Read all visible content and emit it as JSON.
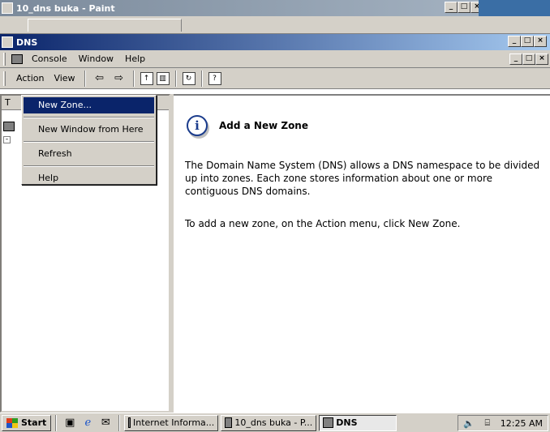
{
  "paint_window": {
    "title": "10_dns buka - Paint",
    "icon": "paint-icon"
  },
  "dns_window": {
    "title": "DNS",
    "icon": "dns-icon"
  },
  "window_buttons": {
    "minimize": "_",
    "maximize": "□",
    "close": "×"
  },
  "menubar": {
    "console": "Console",
    "window": "Window",
    "help": "Help"
  },
  "toolbar": {
    "action": "Action",
    "view": "View",
    "icons": [
      "back-arrow-icon",
      "forward-arrow-icon",
      "up-folder-icon",
      "show-hide-tree-icon",
      "refresh-icon",
      "help-icon"
    ]
  },
  "tree_pane": {
    "header": "T"
  },
  "context_menu": {
    "items": [
      "New Zone...",
      "New Window from Here",
      "Refresh",
      "Help"
    ],
    "highlighted": "New Zone..."
  },
  "detail": {
    "heading": "Add a New Zone",
    "paragraph1": "The Domain Name System (DNS) allows a DNS namespace to be divided up into zones. Each zone stores information about one or more contiguous DNS domains.",
    "paragraph2": "To add a new zone, on the Action menu, click New Zone."
  },
  "taskbar": {
    "start": "Start",
    "quick_launch": [
      "show-desktop-icon",
      "internet-explorer-icon",
      "outlook-express-icon"
    ],
    "tasks": [
      {
        "label": "Internet Informa...",
        "icon": "iis-icon",
        "pressed": false
      },
      {
        "label": "10_dns buka - P...",
        "icon": "paint-icon",
        "pressed": false
      },
      {
        "label": "DNS",
        "icon": "dns-icon",
        "pressed": true
      }
    ],
    "clock": "12:25 AM"
  },
  "colors": {
    "title_active": "#0a246a",
    "title_gradient_end": "#a6caf0",
    "face": "#d4d0c8",
    "highlight": "#0a246a"
  }
}
